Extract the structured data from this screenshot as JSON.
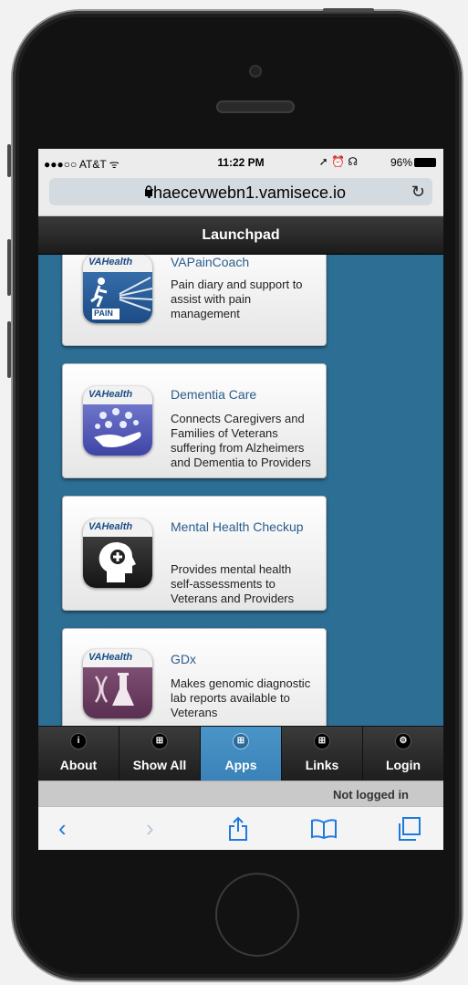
{
  "status": {
    "carrier": "●●●○○ AT&T ᯤ",
    "time": "11:22 PM",
    "indicators": "➚ ⏰ ☊",
    "battery": "96%"
  },
  "browser": {
    "url": "vhaecevwebn1.vamisece.io"
  },
  "header": {
    "title": "Launchpad"
  },
  "apps": [
    {
      "title": "VAPainCoach",
      "description": "Pain diary and support to assist with pain management",
      "icon": "pain-coach-icon"
    },
    {
      "title": "Dementia Care",
      "description": "Connects Caregivers and Families of Veterans suffering from Alzheimers and Dementia to Providers",
      "icon": "dementia-care-icon"
    },
    {
      "title": "Mental Health Checkup",
      "description": "Provides mental health self-assessments to Veterans and Providers",
      "icon": "mental-health-icon"
    },
    {
      "title": "GDx",
      "description": "Makes genomic diagnostic lab reports available to Veterans",
      "icon": "gdx-icon"
    }
  ],
  "icon_brand": "VAHealth",
  "pain_badge": "PAIN",
  "tabs": [
    {
      "label": "About",
      "glyph": "i",
      "active": false
    },
    {
      "label": "Show All",
      "glyph": "⊞",
      "active": false
    },
    {
      "label": "Apps",
      "glyph": "⊞",
      "active": true
    },
    {
      "label": "Links",
      "glyph": "⊞",
      "active": false
    },
    {
      "label": "Login",
      "glyph": "⚙",
      "active": false
    }
  ],
  "login_status": "Not logged in",
  "colors": {
    "page_blue": "#2d6e94",
    "active_tab": "#3a82b8",
    "link_blue": "#2a5d8c"
  }
}
